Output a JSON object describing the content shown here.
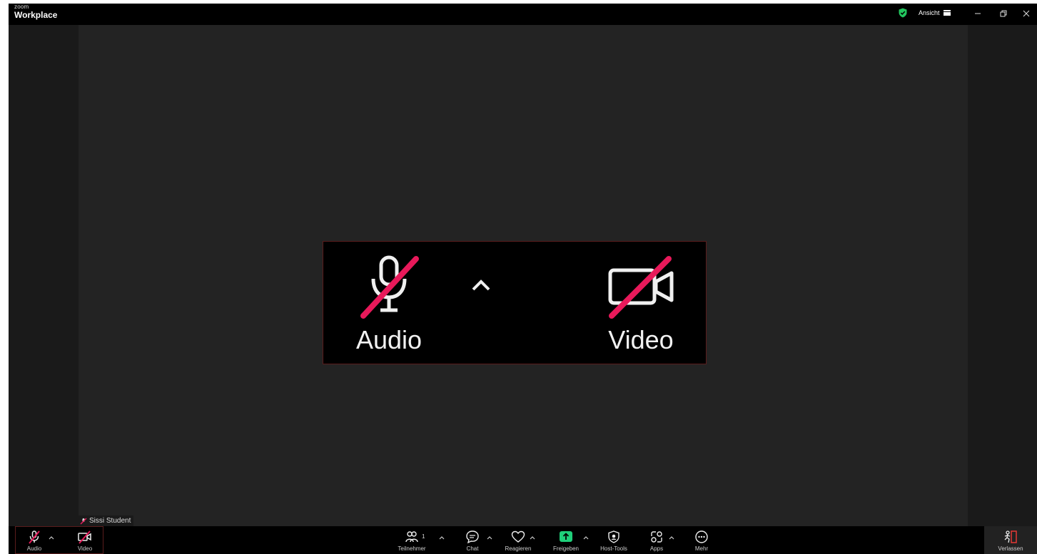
{
  "app": {
    "brand_small": "zoom",
    "brand_big": "Workplace"
  },
  "titlebar": {
    "view_label": "Ansicht"
  },
  "zoom_box": {
    "audio_label": "Audio",
    "video_label": "Video"
  },
  "participant": {
    "name": "Sissi Student"
  },
  "toolbar": {
    "audio": "Audio",
    "video": "Video",
    "participants": "Teilnehmer",
    "participants_count": "1",
    "chat": "Chat",
    "react": "Reagieren",
    "share": "Freigeben",
    "host_tools": "Host-Tools",
    "apps": "Apps",
    "more": "Mehr",
    "leave": "Verlassen"
  },
  "colors": {
    "mute_slash": "#e8195a",
    "share_green": "#1fcf7a",
    "leave_red": "#e53935",
    "shield_green": "#22c55e"
  }
}
